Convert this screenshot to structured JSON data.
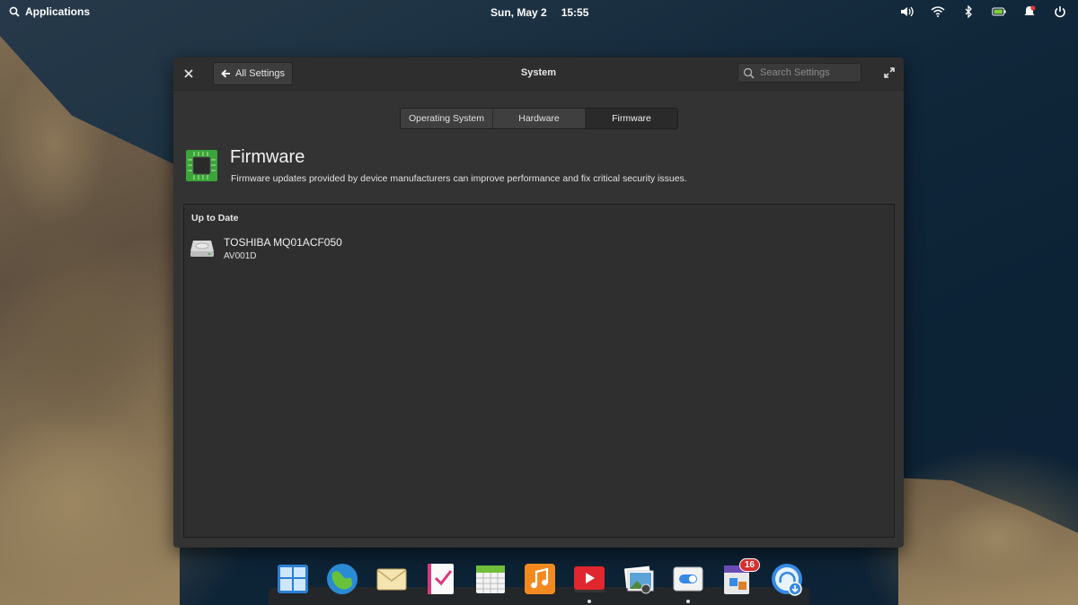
{
  "panel": {
    "applications_label": "Applications",
    "date": "Sun, May  2",
    "time": "15:55",
    "indicators": [
      "volume-icon",
      "wifi-icon",
      "bluetooth-icon",
      "battery-icon",
      "notifications-icon",
      "power-icon"
    ]
  },
  "window": {
    "title": "System",
    "back_label": "All Settings",
    "search_placeholder": "Search Settings",
    "tabs": [
      {
        "label": "Operating System",
        "active": false
      },
      {
        "label": "Hardware",
        "active": false
      },
      {
        "label": "Firmware",
        "active": true
      }
    ],
    "header": {
      "title": "Firmware",
      "description": "Firmware updates provided by device manufacturers can improve performance and fix critical security issues."
    },
    "list": {
      "section_header": "Up to Date",
      "devices": [
        {
          "name": "TOSHIBA MQ01ACF050",
          "version": "AV001D"
        }
      ]
    }
  },
  "dock": {
    "items": [
      "multitasking-view-icon",
      "web-browser-icon",
      "mail-icon",
      "tasks-icon",
      "calendar-icon",
      "music-icon",
      "videos-icon",
      "photos-icon",
      "system-settings-icon",
      "appcenter-icon",
      "updates-icon"
    ],
    "appcenter_badge": "16",
    "accent": "#3689e6"
  }
}
